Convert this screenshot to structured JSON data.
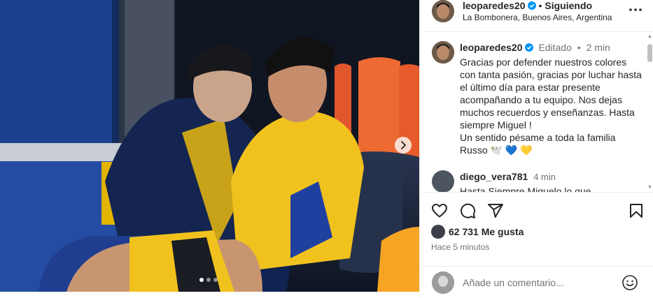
{
  "post": {
    "username": "leoparedes20",
    "follow_status": "Siguiendo",
    "location": "La Bombonera, Buenos Aires, Argentina",
    "media_alt": "Jugadores sentados en el banco de suplentes con camiseta amarilla y azul",
    "carousel_count": 3,
    "carousel_active": 0
  },
  "caption": {
    "username": "leoparedes20",
    "edited": "Editado",
    "time": "2 min",
    "text": "Gracias por defender nuestros colores con tanta pasión, gracias por luchar hasta el último día para estar presente acompañando a tu equipo. Nos dejas muchos recuerdos y enseñanzas. Hasta siempre Miguel !\nUn sentido pésame a toda la familia Russo 🕊️ 💙 💛"
  },
  "comments": [
    {
      "username": "diego_vera781",
      "time": "4 min",
      "text": "Hasta Siempre Miguelo lo que"
    }
  ],
  "stats": {
    "likes": "62 731 Me gusta",
    "time_ago": "Hace 5 minutos"
  },
  "add_comment": {
    "placeholder": "Añade un comentario..."
  },
  "icons": {
    "like": "heart-icon",
    "comment": "comment-icon",
    "share": "send-icon",
    "save": "bookmark-icon",
    "more": "more-icon",
    "next": "chevron-right-icon",
    "emoji": "emoji-icon",
    "verified": "verified-badge-icon"
  },
  "colors": {
    "verified": "#0095f6",
    "secondary_text": "#737373",
    "border": "#efefef"
  }
}
